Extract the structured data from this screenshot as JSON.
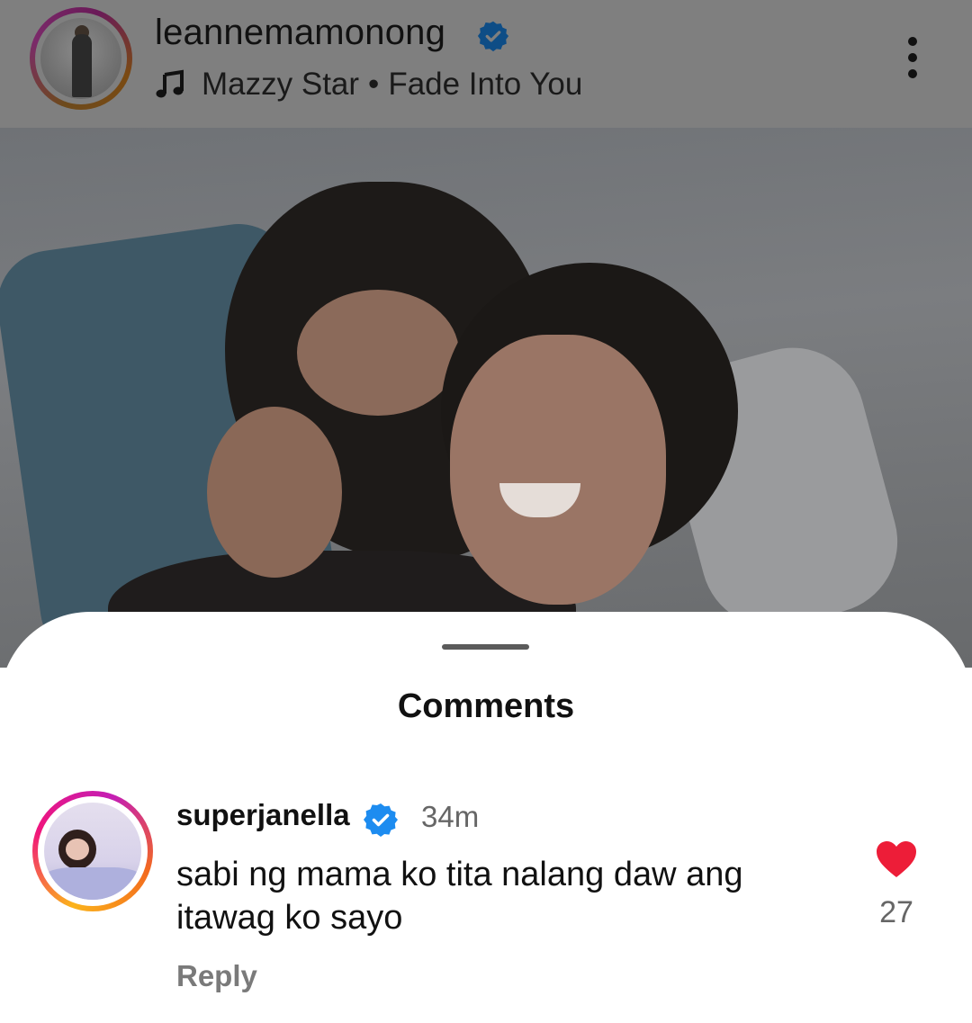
{
  "post_header": {
    "username": "leannemamonong",
    "music_artist": "Mazzy Star",
    "music_separator": "•",
    "music_track": "Fade Into You"
  },
  "comments_sheet": {
    "title": "Comments",
    "comments": [
      {
        "username": "superjanella",
        "time_ago": "34m",
        "text": "sabi ng mama ko tita nalang daw ang itawag ko sayo",
        "reply_label": "Reply",
        "like_count": "27"
      }
    ]
  },
  "colors": {
    "verified_blue": "#1d8cf0",
    "heart_red": "#ed1d38",
    "dim_overlay": "#7f7f7f"
  },
  "icons": [
    "verified-badge-icon",
    "music-note-icon",
    "more-options-icon",
    "heart-icon"
  ]
}
